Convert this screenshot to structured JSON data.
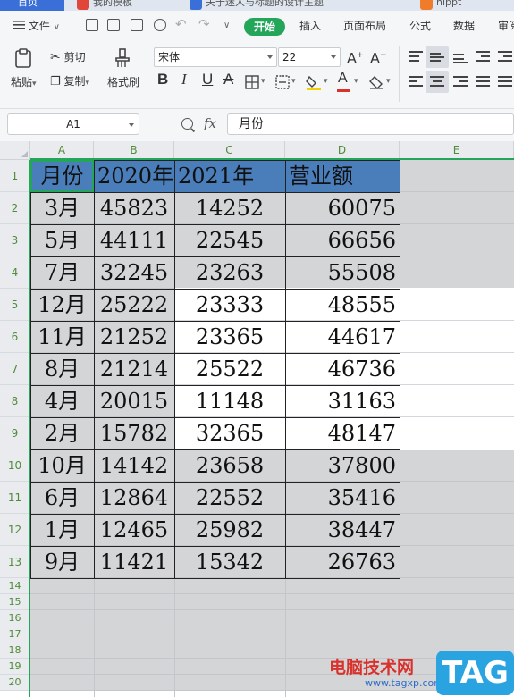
{
  "tabs": [
    {
      "label": "首页"
    },
    {
      "label": "我的模板"
    },
    {
      "label": "关于迷人与标题的设计主题"
    },
    {
      "label": "hippt"
    }
  ],
  "menu": {
    "file_label": "文件",
    "items": [
      "开始",
      "插入",
      "页面布局",
      "公式",
      "数据",
      "审阅"
    ]
  },
  "ribbon": {
    "paste_label": "粘贴",
    "cut_label": "剪切",
    "copy_label": "复制",
    "format_painter_label": "格式刷",
    "font_name": "宋体",
    "font_size": "22",
    "bold_glyph": "B",
    "italic_glyph": "I",
    "underline_glyph": "U",
    "font_color_glyph": "A",
    "highlight_color": "#f5d000",
    "font_color": "#d9322c"
  },
  "formula_bar": {
    "cell_ref": "A1",
    "fx_label": "fx",
    "value": "月份"
  },
  "sheet": {
    "columns": [
      "A",
      "B",
      "C",
      "D",
      "E"
    ],
    "header": [
      "月份",
      "2020年",
      "2021年",
      "营业额"
    ],
    "rows": [
      [
        "3月",
        "45823",
        "14252",
        "60075"
      ],
      [
        "5月",
        "44111",
        "22545",
        "66656"
      ],
      [
        "7月",
        "32245",
        "23263",
        "55508"
      ],
      [
        "12月",
        "25222",
        "23333",
        "48555"
      ],
      [
        "11月",
        "21252",
        "23365",
        "44617"
      ],
      [
        "8月",
        "21214",
        "25522",
        "46736"
      ],
      [
        "4月",
        "20015",
        "11148",
        "31163"
      ],
      [
        "2月",
        "15782",
        "32365",
        "48147"
      ],
      [
        "10月",
        "14142",
        "23658",
        "37800"
      ],
      [
        "6月",
        "12864",
        "22552",
        "35416"
      ],
      [
        "1月",
        "12465",
        "25982",
        "38447"
      ],
      [
        "9月",
        "11421",
        "15342",
        "26763"
      ]
    ],
    "row_numbers": [
      "1",
      "2",
      "3",
      "4",
      "5",
      "6",
      "7",
      "8",
      "9",
      "10",
      "11",
      "12",
      "13",
      "14",
      "15",
      "16",
      "17",
      "18",
      "19",
      "20"
    ],
    "header_fill": "#4a7ebb",
    "selection_fill": "#d4d5d7",
    "accent": "#23a55a"
  },
  "watermark": {
    "title": "电脑技术网",
    "url": "www.tagxp.com",
    "badge": "TAG"
  }
}
